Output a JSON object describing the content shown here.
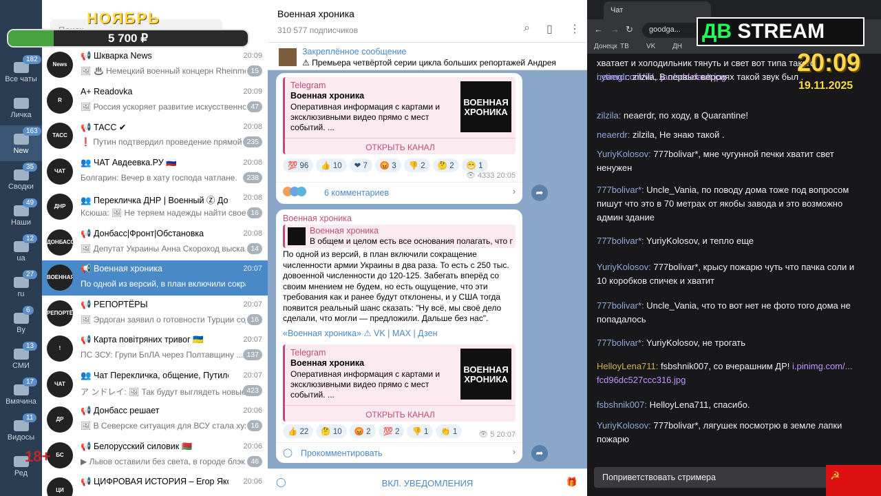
{
  "overlay": {
    "month": "НОЯБРЬ",
    "amount": "5 700 ₽",
    "progress_fraction": 0.19,
    "age": "18+"
  },
  "folders": [
    {
      "label": "Все чаты",
      "badge": "182"
    },
    {
      "label": "Личка",
      "badge": ""
    },
    {
      "label": "New",
      "badge": "163"
    },
    {
      "label": "Сводки",
      "badge": "35"
    },
    {
      "label": "Наши",
      "badge": "49"
    },
    {
      "label": "ua",
      "badge": "12"
    },
    {
      "label": "ru",
      "badge": "27"
    },
    {
      "label": "By",
      "badge": "6"
    },
    {
      "label": "СМИ",
      "badge": "13"
    },
    {
      "label": "Вмячина",
      "badge": "17"
    },
    {
      "label": "Видосы",
      "badge": "11"
    },
    {
      "label": "Ред",
      "badge": ""
    }
  ],
  "search": {
    "placeholder": "Поиск"
  },
  "chats": [
    {
      "name": "📢 Шкварка News",
      "time": "20:09",
      "preview": "🖼 ♨ Немецкий военный концерн Rheinme...",
      "count": "15",
      "avatar": "News"
    },
    {
      "name": "A+ Readovka",
      "time": "20:09",
      "preview": "🖼 Россия ускоряет развитие искусственног...",
      "count": "47",
      "avatar": "R"
    },
    {
      "name": "📢 ТАСС ✔",
      "time": "20:08",
      "preview": "❗ Путин подтвердил проведение прямой ...",
      "count": "235",
      "avatar": "ТАСС"
    },
    {
      "name": "👥 ЧАТ Авдеевка.РУ 🇷🇺",
      "time": "20:08",
      "preview": "Болгарин: Вечер в хату господа чатлане.",
      "count": "238",
      "avatar": "ЧАТ"
    },
    {
      "name": "👥 Перекличка ДНР | Военный Ⓩ Донецк",
      "time": "20:08",
      "preview": "Ксюша: 🖼 Не теряем надежды найти свое...",
      "count": "16",
      "avatar": "ДНР"
    },
    {
      "name": "📢 Донбасс|Фронт|Обстановка",
      "time": "20:08",
      "preview": "🖼 Депутат Украины Анна Скороход выска...",
      "count": "14",
      "avatar": "ДОНБАСС"
    },
    {
      "name": "📢 Военная хроника",
      "time": "20:07",
      "preview": "По одной из версий, в план включили сокращен...",
      "count": "",
      "avatar": "ВОЕННАЯ"
    },
    {
      "name": "📢 РЕПОРТЁРЫ",
      "time": "20:07",
      "preview": "🖼 Эрдоган заявил о готовности Турции сод...",
      "count": "16",
      "avatar": "РЕПОРТЁРЫ"
    },
    {
      "name": "📢 Карта повітряних тривог 🇺🇦",
      "time": "20:07",
      "preview": "ПС ЗСУ: Групи БпЛА через Полтавщину ...",
      "count": "137",
      "avatar": "!"
    },
    {
      "name": "👥 Чат Перекличка, общение, Путиловка ...",
      "time": "20:07",
      "preview": "ア ンドレイ: 🖼 Так будут выглядеть новые б...",
      "count": "423",
      "avatar": "ЧАТ"
    },
    {
      "name": "📢 Донбасс решает",
      "time": "20:06",
      "preview": "🖼 В Северске ситуация для ВСУ стала хуже, ...",
      "count": "16",
      "avatar": "ДР"
    },
    {
      "name": "📢 Белорусский силовик 🇧🇾",
      "time": "20:06",
      "preview": "▶ Львов оставили без света, в городе блэк...",
      "count": "46",
      "avatar": "БС"
    },
    {
      "name": "📢 ЦИФРОВАЯ ИСТОРИЯ – Егор Яковлев",
      "time": "20:06",
      "preview": "",
      "count": "",
      "avatar": "ЦИ"
    }
  ],
  "channel": {
    "title": "Военная хроника",
    "subscribers": "310 577 подписчиков"
  },
  "pinned": {
    "title": "Закреплённое сообщение",
    "text": "⚠ Премьера четвёртой серии цикла больших репортажей Андрея ..."
  },
  "card": {
    "source": "Telegram",
    "name": "Военная хроника",
    "desc": "Оперативная информация с картами и эксклюзивными видео прямо с мест событий. ...",
    "button": "ОТКРЫТЬ КАНАЛ",
    "pic": "ВОЕННАЯ ХРОНИКА"
  },
  "msg1": {
    "reactions": [
      "💯 96",
      "👍 10",
      "❤ 7",
      "😡 3",
      "👎 2",
      "🤔 2",
      "😁 1"
    ],
    "views": "👁 4333  20:05",
    "comments": "6 комментариев"
  },
  "msg2": {
    "author": "Военная хроника",
    "reply_name": "Военная хроника",
    "reply_text": "В общем и целом есть все основания полагать, что по...",
    "text": "По одной из версий, в план включили сокращение численности армии Украины в два раза. То есть с 250 тыс. довоенной численности до 120-125. Забегать вперёд со своим мнением не будем, но есть ощущение, что эти требования как и ранее будут отклонены, и у США тогда появится реальный шанс сказать: \"Ну всё, мы своё дело сделали, что могли — предложили. Дальше без нас\".",
    "links": "«Военная хроника» ⚠ VK | MAX | Дзен",
    "reactions": [
      "👍 22",
      "🤔 10",
      "😡 2",
      "💯 2",
      "👎 1",
      "👏 1"
    ],
    "views": "👁 5  20:07",
    "comments": "Прокомментировать"
  },
  "bottom": {
    "label": "ВКЛ. УВЕДОМЛЕНИЯ"
  },
  "browser": {
    "tab": "Чат",
    "url": "goodga...",
    "bookmarks": [
      "Донецк",
      "ТВ",
      "VK",
      "ДН"
    ]
  },
  "stream": {
    "logo_db": "ДВ",
    "logo_rest": "STREAM",
    "time": "20:09",
    "date": "19.11.2025"
  },
  "twitch": [
    {
      "user": "",
      "text": "хватает и холодильник тянуть и свет вот типа такого",
      "link": "i.ytimg.com/vi/...jao/sddefault.jpg"
    },
    {
      "user": "neaerdr:",
      "text": "zilzila, В первых версиях такой звук был ."
    },
    {
      "user": "zilzila:",
      "text": "neaerdr, по ходу, в Quarantine!"
    },
    {
      "user": "neaerdr:",
      "text": "zilzila, Не знаю такой ."
    },
    {
      "user": "YuriyKolosov:",
      "text": "777bolivar*, мне чугунной печки хватит свет ненужен"
    },
    {
      "user": "777bolivar*:",
      "text": "Uncle_Vania, по поводу дома тоже под вопросом пишут что это в 70 метрах от якобы завода и это возможно админ здание"
    },
    {
      "user": "777bolivar*:",
      "text": "YuriyKolosov, и тепло еще"
    },
    {
      "user": "YuriyKolosov:",
      "text": "777bolivar*, крысу пожарю чуть что пачка соли и 10 коробков спичек и хватит"
    },
    {
      "user": "777bolivar*:",
      "text": "Uncle_Vania, что то вот нет не фото того дома не попадалось"
    },
    {
      "user": "777bolivar*:",
      "text": "YuriyKolosov, не трогать"
    },
    {
      "user": "HelloyLena711:",
      "text": "fsbshnik007, со вчерашним ДР!",
      "link": "i.pinimg.com/... fcd96dc527ccc316.jpg"
    },
    {
      "user": "fsbshnik007:",
      "text": "HelloyLena711, спасибо."
    },
    {
      "user": "YuriyKolosov:",
      "text": "777bolivar*, лягушек посмотрю в земле лапки пожарю"
    }
  ],
  "greet": "Поприветствовать стримера"
}
